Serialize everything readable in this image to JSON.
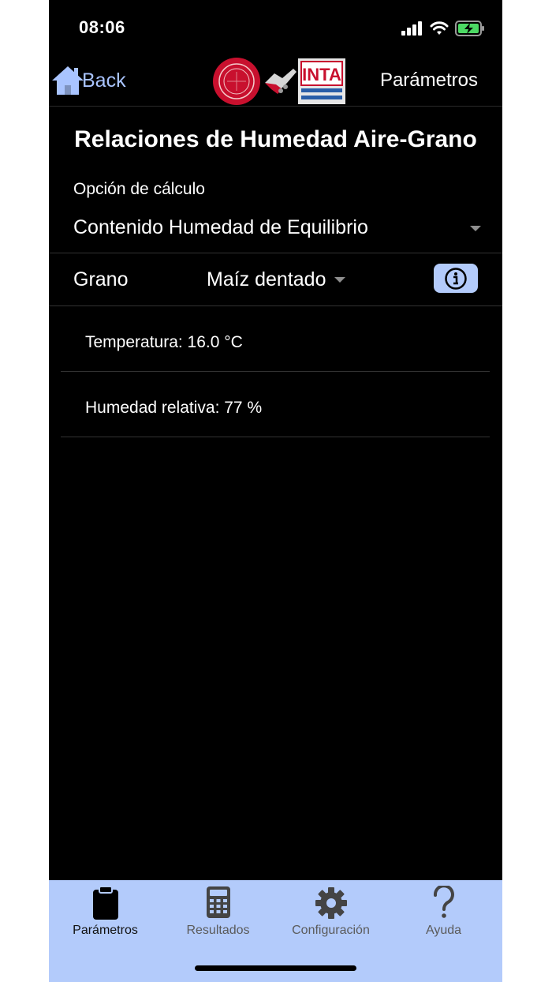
{
  "status": {
    "time": "08:06"
  },
  "nav": {
    "back_label": "Back",
    "title": "Parámetros",
    "logo_right_text": "INTA"
  },
  "page": {
    "title": "Relaciones de Humedad Aire-Grano"
  },
  "calc": {
    "label": "Opción de cálculo",
    "value": "Contenido Humedad de Equilibrio"
  },
  "grano": {
    "label": "Grano",
    "value": "Maíz dentado"
  },
  "params": [
    {
      "text": "Temperatura: 16.0 °C"
    },
    {
      "text": "Humedad relativa: 77 %"
    }
  ],
  "tabs": [
    {
      "label": "Parámetros",
      "icon": "clipboard-icon",
      "active": true
    },
    {
      "label": "Resultados",
      "icon": "calculator-icon",
      "active": false
    },
    {
      "label": "Configuración",
      "icon": "gear-icon",
      "active": false
    },
    {
      "label": "Ayuda",
      "icon": "question-icon",
      "active": false
    }
  ],
  "colors": {
    "accent": "#b3cbfb",
    "back": "#a9c4ff",
    "background": "#000000",
    "isu_red": "#c8102e"
  }
}
